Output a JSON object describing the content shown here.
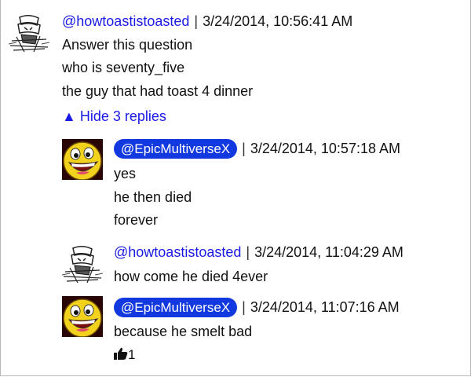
{
  "comments": [
    {
      "author": "@howtoastistoasted",
      "timestamp": "3/24/2014, 10:56:41 AM",
      "avatar_icon": "toast-sketch-avatar",
      "lines": [
        "Answer this question",
        "who is seventy_five",
        "the guy that had toast 4 dinner"
      ],
      "replies_toggle": "▲ Hide 3 replies"
    },
    {
      "author": "@EpicMultiverseX",
      "timestamp": "3/24/2014, 10:57:18 AM",
      "avatar_icon": "epic-face-avatar",
      "lines": [
        "yes",
        "he then died",
        "forever"
      ]
    },
    {
      "author": "@howtoastistoasted",
      "timestamp": "3/24/2014, 11:04:29 AM",
      "avatar_icon": "toast-sketch-avatar",
      "lines": [
        "how come he died 4ever"
      ]
    },
    {
      "author": "@EpicMultiverseX",
      "timestamp": "3/24/2014, 11:07:16 AM",
      "avatar_icon": "epic-face-avatar",
      "lines": [
        "because he smelt bad"
      ],
      "likes": "1"
    }
  ],
  "separator": "|",
  "colors": {
    "link": "#1a1ae6",
    "pill_bg": "#1238e0",
    "pill_text": "#ffffff"
  }
}
